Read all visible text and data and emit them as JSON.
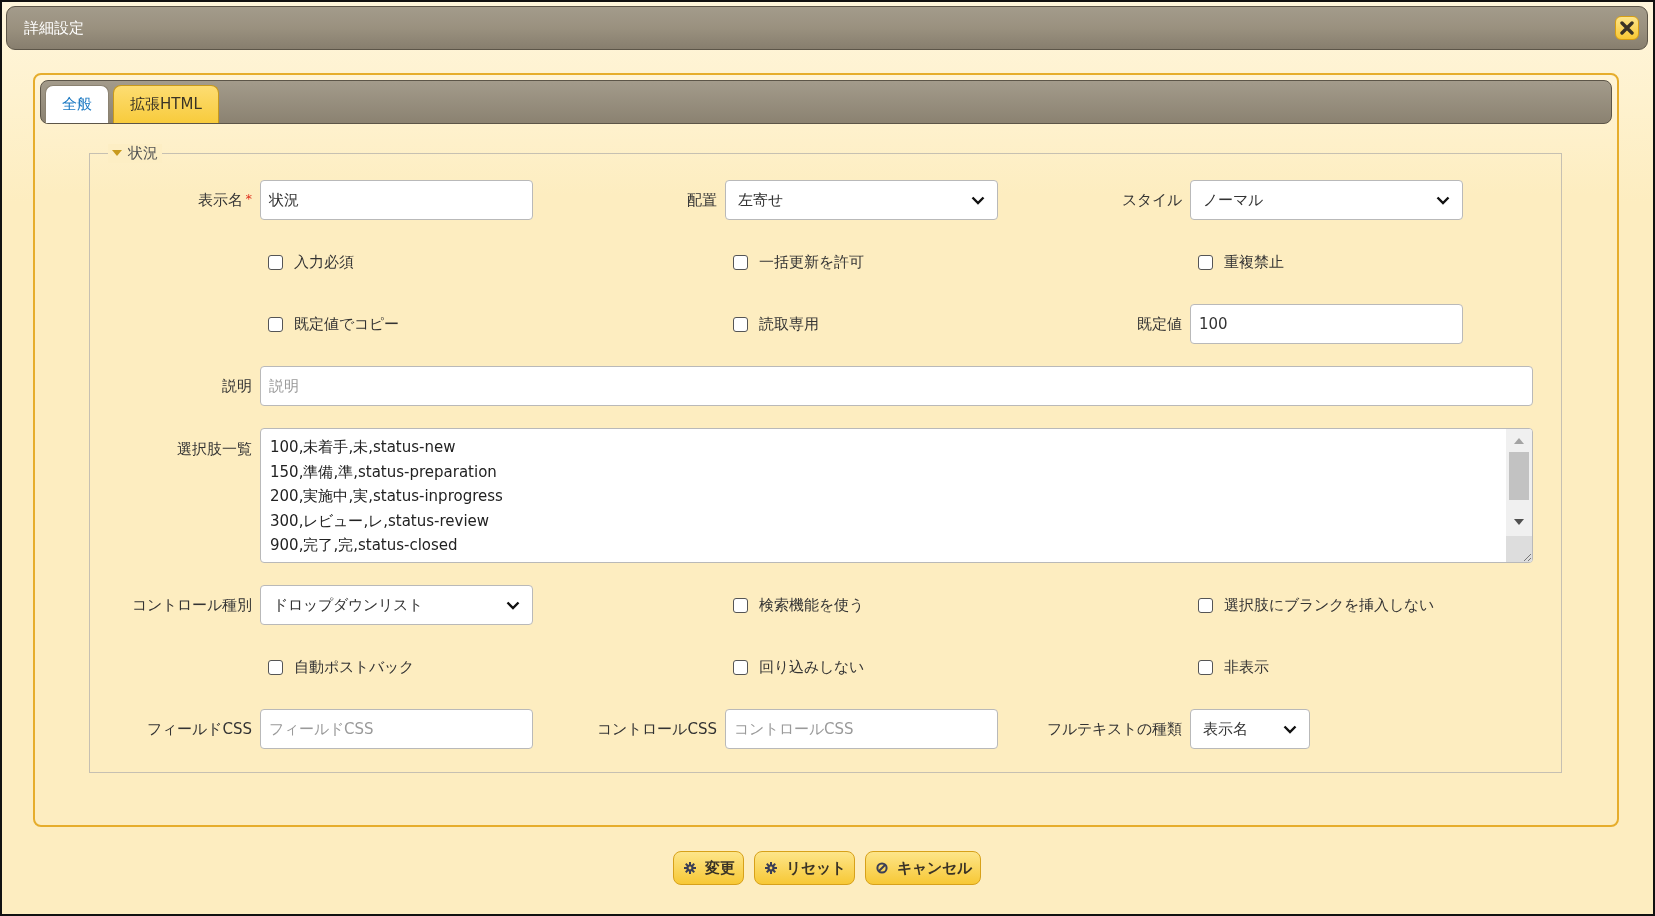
{
  "window": {
    "title": "詳細設定"
  },
  "tabs": [
    {
      "label": "全般",
      "selected": true
    },
    {
      "label": "拡張HTML",
      "selected": false
    }
  ],
  "section": {
    "title": "状況",
    "expanded": true
  },
  "rows": [
    {
      "items": [
        {
          "kind": "text",
          "label": "表示名",
          "required_mark": "*",
          "value": "状況"
        },
        {
          "kind": "select",
          "label": "配置",
          "value": "左寄せ"
        },
        {
          "kind": "select",
          "label": "スタイル",
          "value": "ノーマル"
        }
      ]
    },
    {
      "items": [
        {
          "kind": "checkbox",
          "label": "入力必須",
          "checked": false
        },
        {
          "kind": "checkbox",
          "label": "一括更新を許可",
          "checked": false
        },
        {
          "kind": "checkbox",
          "label": "重複禁止",
          "checked": false
        }
      ]
    },
    {
      "items": [
        {
          "kind": "checkbox",
          "label": "既定値でコピー",
          "checked": false
        },
        {
          "kind": "checkbox",
          "label": "読取専用",
          "checked": false
        },
        {
          "kind": "text",
          "label": "既定値",
          "value": "100"
        }
      ]
    },
    {
      "items": [
        {
          "kind": "wide",
          "label": "説明",
          "placeholder": "説明"
        }
      ]
    },
    {
      "items": [
        {
          "kind": "textarea",
          "label": "選択肢一覧",
          "lines": [
            "100,未着手,未,status-new",
            "150,準備,準,status-preparation",
            "200,実施中,実,status-inprogress",
            "300,レビュー,レ,status-review",
            "900,完了,完,status-closed"
          ]
        }
      ]
    },
    {
      "items": [
        {
          "kind": "select",
          "label": "コントロール種別",
          "value": "ドロップダウンリスト"
        },
        {
          "kind": "checkbox",
          "label": "検索機能を使う",
          "checked": false
        },
        {
          "kind": "checkbox",
          "label": "選択肢にブランクを挿入しない",
          "checked": false
        }
      ]
    },
    {
      "items": [
        {
          "kind": "checkbox",
          "label": "自動ポストバック",
          "checked": false
        },
        {
          "kind": "checkbox",
          "label": "回り込みしない",
          "checked": false
        },
        {
          "kind": "checkbox",
          "label": "非表示",
          "checked": false
        }
      ]
    },
    {
      "items": [
        {
          "kind": "text",
          "label": "フィールドCSS",
          "placeholder": "フィールドCSS"
        },
        {
          "kind": "text",
          "label": "コントロールCSS",
          "placeholder": "コントロールCSS"
        },
        {
          "kind": "select",
          "label": "フルテキストの種類",
          "value": "表示名"
        }
      ]
    }
  ],
  "buttons": [
    {
      "label": "変更",
      "kind": "gear"
    },
    {
      "label": "リセット",
      "kind": "gear"
    },
    {
      "label": "キャンセル",
      "kind": "cancel"
    }
  ]
}
